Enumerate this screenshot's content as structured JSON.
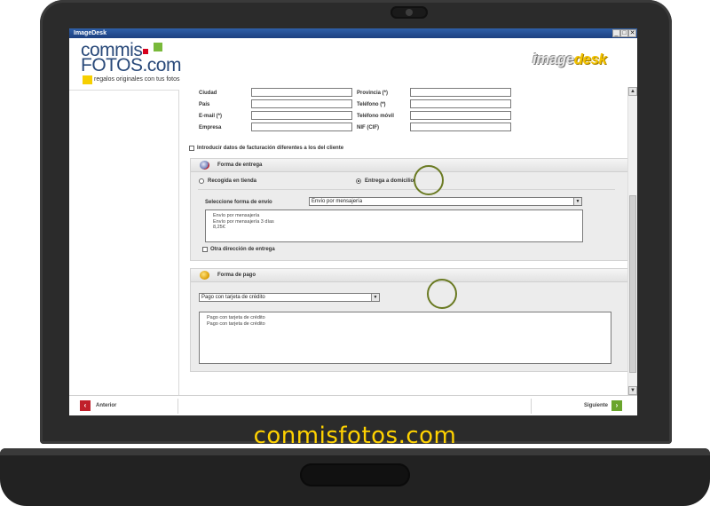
{
  "window": {
    "title": "ImageDesk",
    "buttons": [
      "_",
      "□",
      "✕"
    ]
  },
  "header": {
    "logo_line1": "commis",
    "logo_line2": "FOTOS.com",
    "tagline": "regalos originales con tus fotos",
    "brand_logo_a": "image",
    "brand_logo_b": "desk"
  },
  "address_form": {
    "left_fields": [
      {
        "label": "Ciudad",
        "value": ""
      },
      {
        "label": "País",
        "value": ""
      },
      {
        "label": "E-mail (*)",
        "value": ""
      },
      {
        "label": "Empresa",
        "value": ""
      }
    ],
    "right_fields": [
      {
        "label": "Provincia (*)",
        "value": ""
      },
      {
        "label": "Teléfono (*)",
        "value": ""
      },
      {
        "label": "Teléfono móvil",
        "value": ""
      },
      {
        "label": "NIF (CIF)",
        "value": ""
      }
    ]
  },
  "billing_checkbox": {
    "label": "Introducir datos de facturación diferentes a los del cliente",
    "checked": false
  },
  "delivery": {
    "title": "Forma de entrega",
    "options": [
      {
        "label": "Recogida en tienda",
        "selected": false
      },
      {
        "label": "Entrega a domicilio",
        "selected": true
      }
    ],
    "method_label": "Seleccione forma de envío",
    "method_value": "Envío por mensajería",
    "details": [
      "Envío por mensajería",
      "Envío por mensajería 3 días",
      "8,25€"
    ],
    "other_address": {
      "label": "Otra dirección de entrega",
      "checked": false
    }
  },
  "payment": {
    "title": "Forma de pago",
    "method_value": "Pago con tarjeta de crédito",
    "details": [
      "Pago con tarjeta de crédito",
      "Pago con tarjeta de crédito"
    ]
  },
  "footer": {
    "prev_label": "Anterior",
    "next_label": "Siguiente"
  },
  "brand_caption": "conmisfotos.com",
  "colors": {
    "accent_green": "#79b93a",
    "accent_red": "#d6001c",
    "brand_yellow": "#ffd200",
    "title_blue": "#1b3f80"
  }
}
